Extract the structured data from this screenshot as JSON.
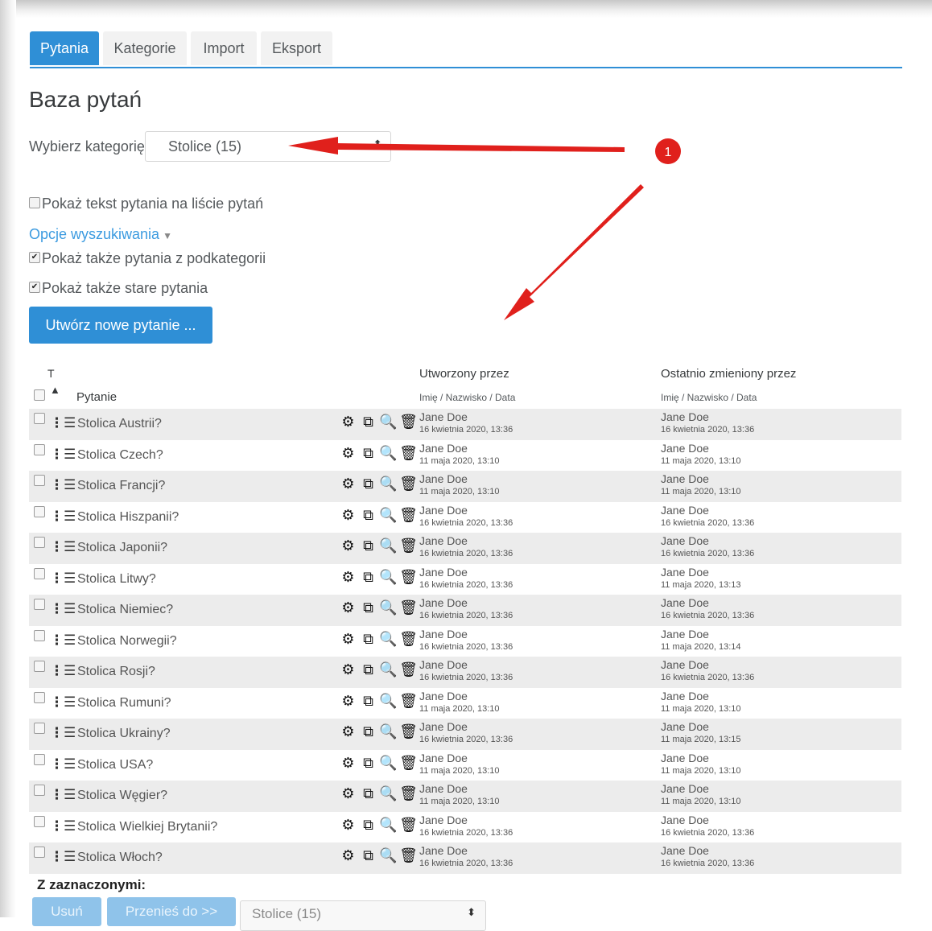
{
  "tabs": [
    "Pytania",
    "Kategorie",
    "Import",
    "Eksport"
  ],
  "page_title": "Baza pytań",
  "category": {
    "label": "Wybierz kategorię:",
    "selected": "Stolice (15)"
  },
  "options": {
    "show_text": "Pokaż tekst pytania na liście pytań",
    "search_options": "Opcje wyszukiwania",
    "subcategories": "Pokaż także pytania z podkategorii",
    "old_questions": "Pokaż także stare pytania"
  },
  "create_button": "Utwórz nowe pytanie ...",
  "table": {
    "col_type": "T",
    "col_question": "Pytanie",
    "col_created": "Utworzony przez",
    "col_modified": "Ostatnio zmieniony przez",
    "sub_created": "Imię / Nazwisko / Data",
    "sub_modified": "Imię / Nazwisko / Data",
    "rows": [
      {
        "name": "Stolica Austrii?",
        "created_by": "Jane Doe",
        "created_at": "16 kwietnia 2020, 13:36",
        "modified_by": "Jane Doe",
        "modified_at": "16 kwietnia 2020, 13:36"
      },
      {
        "name": "Stolica Czech?",
        "created_by": "Jane Doe",
        "created_at": "11 maja 2020, 13:10",
        "modified_by": "Jane Doe",
        "modified_at": "11 maja 2020, 13:10"
      },
      {
        "name": "Stolica Francji?",
        "created_by": "Jane Doe",
        "created_at": "11 maja 2020, 13:10",
        "modified_by": "Jane Doe",
        "modified_at": "11 maja 2020, 13:10"
      },
      {
        "name": "Stolica Hiszpanii?",
        "created_by": "Jane Doe",
        "created_at": "16 kwietnia 2020, 13:36",
        "modified_by": "Jane Doe",
        "modified_at": "16 kwietnia 2020, 13:36"
      },
      {
        "name": "Stolica Japonii?",
        "created_by": "Jane Doe",
        "created_at": "16 kwietnia 2020, 13:36",
        "modified_by": "Jane Doe",
        "modified_at": "16 kwietnia 2020, 13:36"
      },
      {
        "name": "Stolica Litwy?",
        "created_by": "Jane Doe",
        "created_at": "16 kwietnia 2020, 13:36",
        "modified_by": "Jane Doe",
        "modified_at": "11 maja 2020, 13:13"
      },
      {
        "name": "Stolica Niemiec?",
        "created_by": "Jane Doe",
        "created_at": "16 kwietnia 2020, 13:36",
        "modified_by": "Jane Doe",
        "modified_at": "16 kwietnia 2020, 13:36"
      },
      {
        "name": "Stolica Norwegii?",
        "created_by": "Jane Doe",
        "created_at": "16 kwietnia 2020, 13:36",
        "modified_by": "Jane Doe",
        "modified_at": "11 maja 2020, 13:14"
      },
      {
        "name": "Stolica Rosji?",
        "created_by": "Jane Doe",
        "created_at": "16 kwietnia 2020, 13:36",
        "modified_by": "Jane Doe",
        "modified_at": "16 kwietnia 2020, 13:36"
      },
      {
        "name": "Stolica Rumuni?",
        "created_by": "Jane Doe",
        "created_at": "11 maja 2020, 13:10",
        "modified_by": "Jane Doe",
        "modified_at": "11 maja 2020, 13:10"
      },
      {
        "name": "Stolica Ukrainy?",
        "created_by": "Jane Doe",
        "created_at": "16 kwietnia 2020, 13:36",
        "modified_by": "Jane Doe",
        "modified_at": "11 maja 2020, 13:15"
      },
      {
        "name": "Stolica USA?",
        "created_by": "Jane Doe",
        "created_at": "11 maja 2020, 13:10",
        "modified_by": "Jane Doe",
        "modified_at": "11 maja 2020, 13:10"
      },
      {
        "name": "Stolica Węgier?",
        "created_by": "Jane Doe",
        "created_at": "11 maja 2020, 13:10",
        "modified_by": "Jane Doe",
        "modified_at": "11 maja 2020, 13:10"
      },
      {
        "name": "Stolica Wielkiej Brytanii?",
        "created_by": "Jane Doe",
        "created_at": "16 kwietnia 2020, 13:36",
        "modified_by": "Jane Doe",
        "modified_at": "16 kwietnia 2020, 13:36"
      },
      {
        "name": "Stolica Włoch?",
        "created_by": "Jane Doe",
        "created_at": "16 kwietnia 2020, 13:36",
        "modified_by": "Jane Doe",
        "modified_at": "16 kwietnia 2020, 13:36"
      }
    ]
  },
  "bulk": {
    "label": "Z zaznaczonymi:",
    "delete": "Usuń",
    "move": "Przenieś do >>",
    "target": "Stolice (15)"
  },
  "annotation": {
    "marker": "1",
    "color": "#e0201c"
  },
  "icons": {
    "row_type": "multichoice-list-icon",
    "actions": [
      "gear-icon",
      "duplicate-icon",
      "preview-icon",
      "trash-icon"
    ],
    "sort": "caret-up-icon"
  }
}
